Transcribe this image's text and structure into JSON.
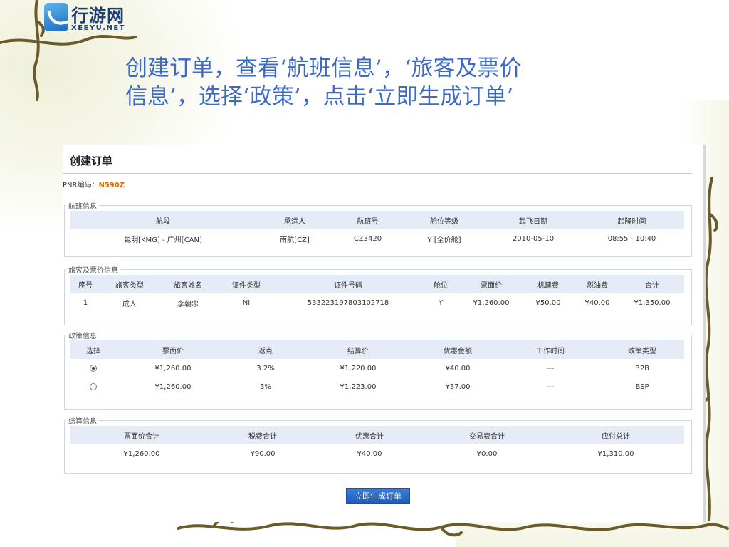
{
  "logo": {
    "cn": "行游网",
    "en": "XEEYU.NET"
  },
  "headline": {
    "line1": "创建订单，查看‘航班信息’，‘旅客及票价",
    "line2": "信息’，选择‘政策’，点击‘立即生成订单’"
  },
  "form": {
    "title": "创建订单",
    "pnr_label": "PNR编码：",
    "pnr_value": "N590Z"
  },
  "flight": {
    "legend": "航班信息",
    "headers": [
      "航段",
      "承运人",
      "航班号",
      "舱位等级",
      "起飞日期",
      "起降时间"
    ],
    "rows": [
      [
        "昆明[KMG] - 广州[CAN]",
        "南航[CZ]",
        "CZ3420",
        "Y [全价舱]",
        "2010-05-10",
        "08:55 - 10:40"
      ]
    ]
  },
  "passenger": {
    "legend": "旅客及票价信息",
    "headers": [
      "序号",
      "旅客类型",
      "旅客姓名",
      "证件类型",
      "证件号码",
      "舱位",
      "票面价",
      "机建费",
      "燃油费",
      "合计"
    ],
    "rows": [
      [
        "1",
        "成人",
        "李朝忠",
        "NI",
        "533223197803102718",
        "Y",
        "¥1,260.00",
        "¥50.00",
        "¥40.00",
        "¥1,350.00"
      ]
    ]
  },
  "policy": {
    "legend": "政策信息",
    "headers": [
      "选择",
      "票面价",
      "返点",
      "结算价",
      "优惠金额",
      "工作时间",
      "政策类型"
    ],
    "rows": [
      {
        "selected": true,
        "cells": [
          "¥1,260.00",
          "3.2%",
          "¥1,220.00",
          "¥40.00",
          "---",
          "B2B"
        ]
      },
      {
        "selected": false,
        "cells": [
          "¥1,260.00",
          "3%",
          "¥1,223.00",
          "¥37.00",
          "---",
          "BSP"
        ]
      }
    ]
  },
  "settlement": {
    "legend": "结算信息",
    "headers": [
      "票面价合计",
      "税费合计",
      "优惠合计",
      "交易费合计",
      "应付总计"
    ],
    "values": [
      "¥1,260.00",
      "¥90.00",
      "¥40.00",
      "¥0.00",
      "¥1,310.00"
    ]
  },
  "submit_label": "立即生成订单",
  "colors": {
    "accent": "#3d6bc4",
    "header_bg": "#e5ecf7",
    "highlight": "#e00000",
    "pnr": "#e07000"
  }
}
